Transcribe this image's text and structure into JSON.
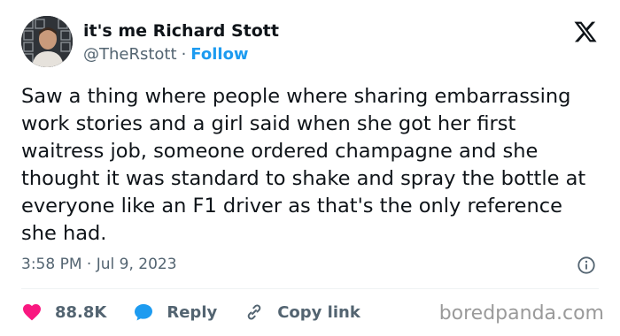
{
  "user": {
    "display_name": "it's me Richard Stott",
    "handle": "@TheRstott",
    "separator": "·",
    "follow_label": "Follow"
  },
  "tweet": {
    "text": "Saw a thing where people where sharing embarrassing work stories and a girl said when she got her first waitress job, someone ordered champagne and she thought it was standard to shake and spray the bottle at everyone like an F1 driver as that's the only reference she had.",
    "time": "3:58 PM",
    "meta_separator": "·",
    "date": "Jul 9, 2023"
  },
  "actions": {
    "like_count": "88.8K",
    "reply_label": "Reply",
    "copy_link_label": "Copy link"
  },
  "watermark": "boredpanda.com",
  "icons": {
    "logo": "x-logo-icon",
    "info": "info-icon",
    "like": "heart-icon",
    "reply": "speech-bubble-icon",
    "copy": "link-icon"
  },
  "colors": {
    "accent": "#1d9bf0",
    "like": "#f91880",
    "secondary_text": "#536471",
    "primary_text": "#0f1419"
  }
}
